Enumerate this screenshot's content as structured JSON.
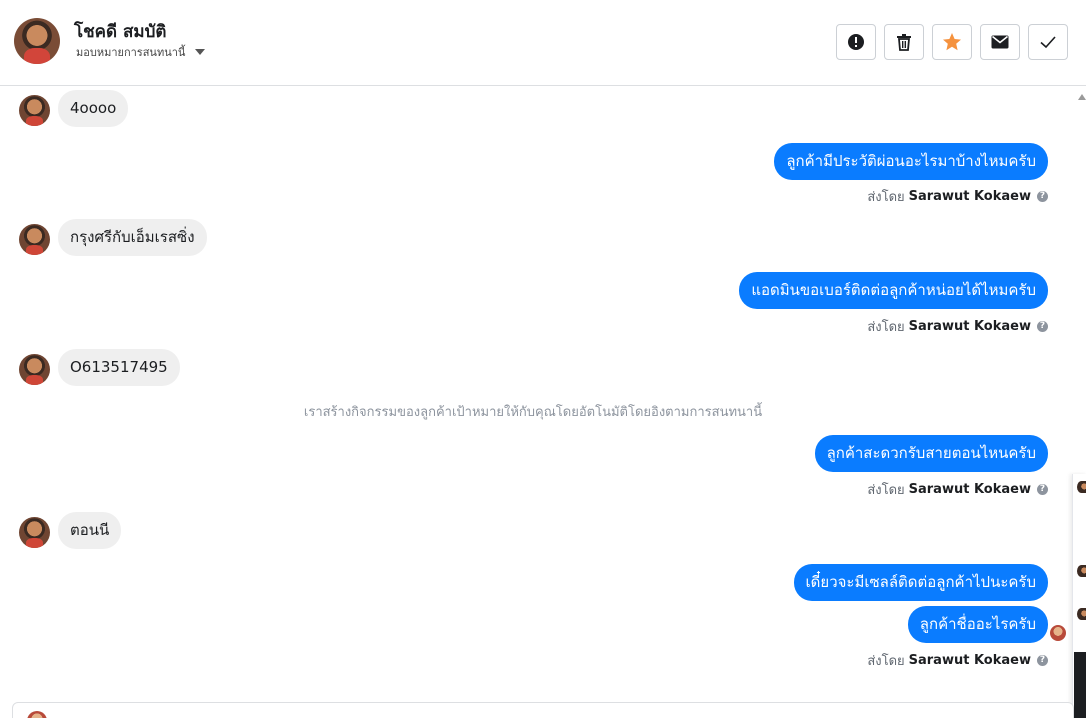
{
  "header": {
    "contact_name": "โชคดี สมบัติ",
    "assign_label": "มอบหมายการสนทนานี้",
    "actions": {
      "spam": "alert-icon",
      "delete": "trash-icon",
      "star": "star-icon",
      "mark_unread": "envelope-icon",
      "done": "check-icon"
    },
    "star_color": "#f5923e"
  },
  "conversation": {
    "messages": [
      {
        "dir": "in",
        "text": "4oooo"
      },
      {
        "dir": "out",
        "text": "ลูกค้ามีประวัติผ่อนอะไรมาบ้างไหมครับ",
        "sent_by_prefix": "ส่งโดย",
        "sent_by_agent": "Sarawut Kokaew"
      },
      {
        "dir": "in",
        "text": "กรุงศรีกับเอ็มเรสซิ่ง"
      },
      {
        "dir": "out",
        "text": "แอดมินขอเบอร์ติดต่อลูกค้าหน่อยได้ไหมครับ",
        "sent_by_prefix": "ส่งโดย",
        "sent_by_agent": "Sarawut Kokaew"
      },
      {
        "dir": "in",
        "text": "O613517495"
      },
      {
        "dir": "system",
        "text": "เราสร้างกิจกรรมของลูกค้าเป้าหมายให้กับคุณโดยอัตโนมัติโดยอิงตามการสนทนานี้"
      },
      {
        "dir": "out",
        "text": "ลูกค้าสะดวกรับสายตอนไหนครับ",
        "sent_by_prefix": "ส่งโดย",
        "sent_by_agent": "Sarawut Kokaew"
      },
      {
        "dir": "in",
        "text": "ตอนนี"
      },
      {
        "dir": "out",
        "text": "เดี๋ยวจะมีเซลล์ติดต่อลูกค้าไปนะครับ"
      },
      {
        "dir": "out",
        "text": "ลูกค้าชื่ออะไรครับ",
        "sent_by_prefix": "ส่งโดย",
        "sent_by_agent": "Sarawut Kokaew"
      }
    ],
    "outgoing_color": "#0a7cff",
    "incoming_color": "#efefef"
  }
}
